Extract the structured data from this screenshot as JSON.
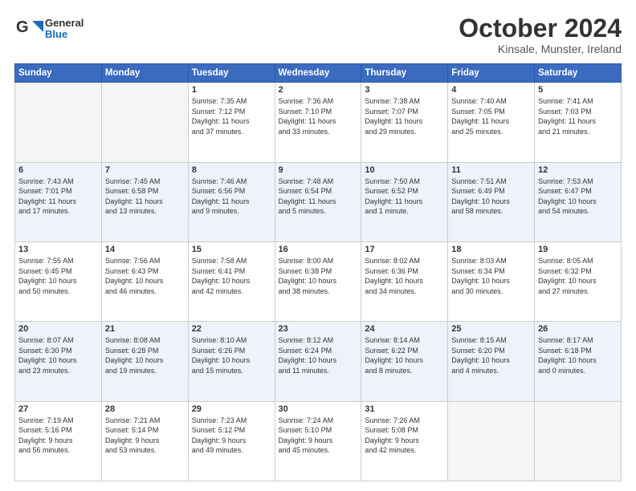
{
  "header": {
    "logo_general": "General",
    "logo_blue": "Blue",
    "month_title": "October 2024",
    "location": "Kinsale, Munster, Ireland"
  },
  "weekdays": [
    "Sunday",
    "Monday",
    "Tuesday",
    "Wednesday",
    "Thursday",
    "Friday",
    "Saturday"
  ],
  "weeks": [
    [
      {
        "day": "",
        "info": ""
      },
      {
        "day": "",
        "info": ""
      },
      {
        "day": "1",
        "info": "Sunrise: 7:35 AM\nSunset: 7:12 PM\nDaylight: 11 hours\nand 37 minutes."
      },
      {
        "day": "2",
        "info": "Sunrise: 7:36 AM\nSunset: 7:10 PM\nDaylight: 11 hours\nand 33 minutes."
      },
      {
        "day": "3",
        "info": "Sunrise: 7:38 AM\nSunset: 7:07 PM\nDaylight: 11 hours\nand 29 minutes."
      },
      {
        "day": "4",
        "info": "Sunrise: 7:40 AM\nSunset: 7:05 PM\nDaylight: 11 hours\nand 25 minutes."
      },
      {
        "day": "5",
        "info": "Sunrise: 7:41 AM\nSunset: 7:03 PM\nDaylight: 11 hours\nand 21 minutes."
      }
    ],
    [
      {
        "day": "6",
        "info": "Sunrise: 7:43 AM\nSunset: 7:01 PM\nDaylight: 11 hours\nand 17 minutes."
      },
      {
        "day": "7",
        "info": "Sunrise: 7:45 AM\nSunset: 6:58 PM\nDaylight: 11 hours\nand 13 minutes."
      },
      {
        "day": "8",
        "info": "Sunrise: 7:46 AM\nSunset: 6:56 PM\nDaylight: 11 hours\nand 9 minutes."
      },
      {
        "day": "9",
        "info": "Sunrise: 7:48 AM\nSunset: 6:54 PM\nDaylight: 11 hours\nand 5 minutes."
      },
      {
        "day": "10",
        "info": "Sunrise: 7:50 AM\nSunset: 6:52 PM\nDaylight: 11 hours\nand 1 minute."
      },
      {
        "day": "11",
        "info": "Sunrise: 7:51 AM\nSunset: 6:49 PM\nDaylight: 10 hours\nand 58 minutes."
      },
      {
        "day": "12",
        "info": "Sunrise: 7:53 AM\nSunset: 6:47 PM\nDaylight: 10 hours\nand 54 minutes."
      }
    ],
    [
      {
        "day": "13",
        "info": "Sunrise: 7:55 AM\nSunset: 6:45 PM\nDaylight: 10 hours\nand 50 minutes."
      },
      {
        "day": "14",
        "info": "Sunrise: 7:56 AM\nSunset: 6:43 PM\nDaylight: 10 hours\nand 46 minutes."
      },
      {
        "day": "15",
        "info": "Sunrise: 7:58 AM\nSunset: 6:41 PM\nDaylight: 10 hours\nand 42 minutes."
      },
      {
        "day": "16",
        "info": "Sunrise: 8:00 AM\nSunset: 6:38 PM\nDaylight: 10 hours\nand 38 minutes."
      },
      {
        "day": "17",
        "info": "Sunrise: 8:02 AM\nSunset: 6:36 PM\nDaylight: 10 hours\nand 34 minutes."
      },
      {
        "day": "18",
        "info": "Sunrise: 8:03 AM\nSunset: 6:34 PM\nDaylight: 10 hours\nand 30 minutes."
      },
      {
        "day": "19",
        "info": "Sunrise: 8:05 AM\nSunset: 6:32 PM\nDaylight: 10 hours\nand 27 minutes."
      }
    ],
    [
      {
        "day": "20",
        "info": "Sunrise: 8:07 AM\nSunset: 6:30 PM\nDaylight: 10 hours\nand 23 minutes."
      },
      {
        "day": "21",
        "info": "Sunrise: 8:08 AM\nSunset: 6:28 PM\nDaylight: 10 hours\nand 19 minutes."
      },
      {
        "day": "22",
        "info": "Sunrise: 8:10 AM\nSunset: 6:26 PM\nDaylight: 10 hours\nand 15 minutes."
      },
      {
        "day": "23",
        "info": "Sunrise: 8:12 AM\nSunset: 6:24 PM\nDaylight: 10 hours\nand 11 minutes."
      },
      {
        "day": "24",
        "info": "Sunrise: 8:14 AM\nSunset: 6:22 PM\nDaylight: 10 hours\nand 8 minutes."
      },
      {
        "day": "25",
        "info": "Sunrise: 8:15 AM\nSunset: 6:20 PM\nDaylight: 10 hours\nand 4 minutes."
      },
      {
        "day": "26",
        "info": "Sunrise: 8:17 AM\nSunset: 6:18 PM\nDaylight: 10 hours\nand 0 minutes."
      }
    ],
    [
      {
        "day": "27",
        "info": "Sunrise: 7:19 AM\nSunset: 5:16 PM\nDaylight: 9 hours\nand 56 minutes."
      },
      {
        "day": "28",
        "info": "Sunrise: 7:21 AM\nSunset: 5:14 PM\nDaylight: 9 hours\nand 53 minutes."
      },
      {
        "day": "29",
        "info": "Sunrise: 7:23 AM\nSunset: 5:12 PM\nDaylight: 9 hours\nand 49 minutes."
      },
      {
        "day": "30",
        "info": "Sunrise: 7:24 AM\nSunset: 5:10 PM\nDaylight: 9 hours\nand 45 minutes."
      },
      {
        "day": "31",
        "info": "Sunrise: 7:26 AM\nSunset: 5:08 PM\nDaylight: 9 hours\nand 42 minutes."
      },
      {
        "day": "",
        "info": ""
      },
      {
        "day": "",
        "info": ""
      }
    ]
  ]
}
